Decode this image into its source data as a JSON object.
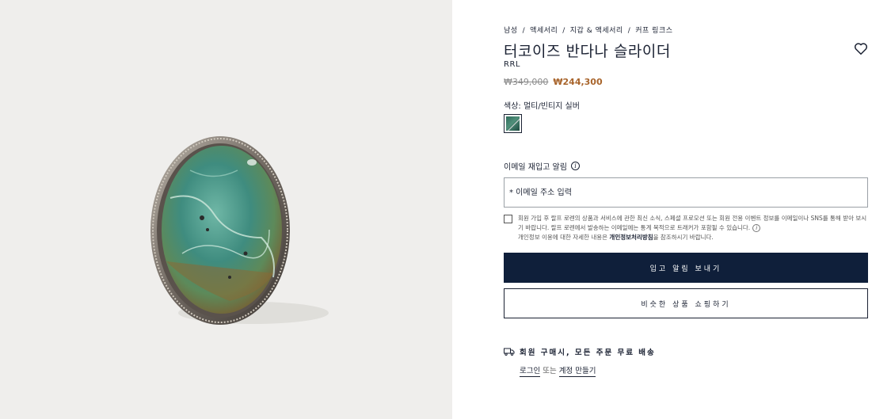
{
  "breadcrumb": [
    "남성",
    "액세서리",
    "지갑 & 액세서리",
    "커프 링크스"
  ],
  "product": {
    "title": "터코이즈 반다나 슬라이더",
    "brand": "RRL",
    "original_price": "₩349,000",
    "sale_price": "₩244,300",
    "color_label": "색상: 멀티/빈티지 실버",
    "swatch_color": "#2f6a5a"
  },
  "restock": {
    "label": "이메일 재입고 알림",
    "email_placeholder": "* 이메일 주소 입력",
    "consent_text": "회원 가입 후 랄프 로렌의 상품과 서비스에 관한 최신 소식, 스페셜 프로모션 또는 회원 전용 이벤트 정보를 이메일이나 SNS를 통해 받아 보시기 바랍니다. 랄프 로렌에서 발송하는 이메일에는 통계 목적으로 트래커가 포함될 수 있습니다.",
    "privacy_prefix": "개인정보 이용에 대한 자세한 내용은 ",
    "privacy_link": "개인정보처리방침",
    "privacy_suffix": "을 참조하시기 바랍니다."
  },
  "buttons": {
    "notify": "입고 알림 보내기",
    "similar": "비슷한 상품 쇼핑하기"
  },
  "shipping": {
    "text": "회원 구매시, 모든 주문 무료 배송",
    "login": "로그인",
    "or": "또는",
    "create_account": "계정 만들기"
  },
  "colors": {
    "navy": "#0f1f3a",
    "sale": "#a8642b",
    "image_bg": "#efeeec"
  }
}
